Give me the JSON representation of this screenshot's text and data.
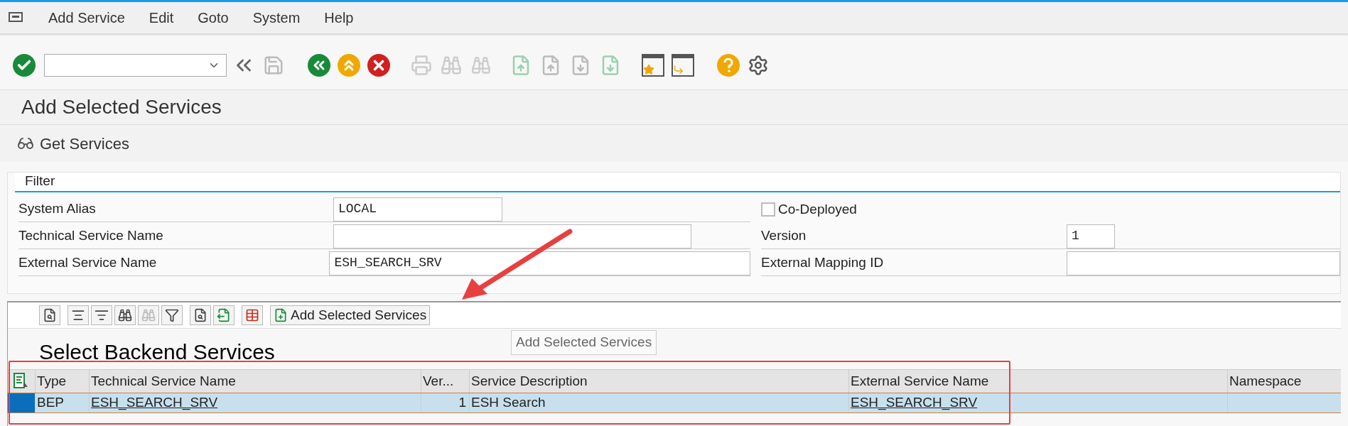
{
  "menu_bar": {
    "items": [
      "Add Service",
      "Edit",
      "Goto",
      "System",
      "Help"
    ]
  },
  "title": "Add Selected Services",
  "get_services_button": "Get Services",
  "filter": {
    "title": "Filter",
    "left_fields": [
      {
        "label": "System Alias",
        "value": "LOCAL"
      },
      {
        "label": "Technical Service Name"
      },
      {
        "label": "External Service Name",
        "value": "ESH_SEARCH_SRV"
      }
    ],
    "co_deployed": {
      "label": "Co-Deployed",
      "checked": false
    },
    "right_fields": [
      {
        "label": "Version",
        "value": "1"
      },
      {
        "label": "External Mapping ID"
      }
    ]
  },
  "table_toolbar": {
    "add_button": "Add Selected Services",
    "tooltip": "Add Selected Services"
  },
  "section_title": "Select Backend Services",
  "table": {
    "columns": [
      {
        "label": "Type",
        "kind": "text"
      },
      {
        "label": "Technical Service Name",
        "kind": "link"
      },
      {
        "label": "Ver...",
        "kind": "number"
      },
      {
        "label": "Service Description",
        "kind": "text"
      },
      {
        "label": "External Service Name",
        "kind": "link"
      },
      {
        "label": "Namespace",
        "kind": "text"
      }
    ],
    "rows": [
      {
        "selected": true,
        "cells": [
          "BEP",
          "ESH_SEARCH_SRV",
          "1",
          "ESH Search",
          "ESH_SEARCH_SRV",
          null
        ]
      }
    ]
  }
}
